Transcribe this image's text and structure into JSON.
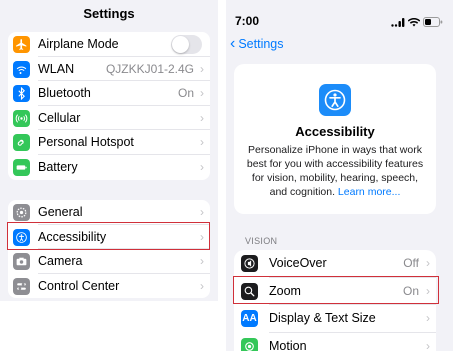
{
  "left": {
    "title": "Settings",
    "group1": [
      {
        "label": "Airplane Mode",
        "icon": "airplane-icon",
        "color": "#ff9500",
        "toggle": true,
        "toggle_on": false
      },
      {
        "label": "WLAN",
        "value": "QJZKKJ01-2.4G",
        "icon": "wifi-icon",
        "color": "#007aff"
      },
      {
        "label": "Bluetooth",
        "value": "On",
        "icon": "bluetooth-icon",
        "color": "#007aff"
      },
      {
        "label": "Cellular",
        "icon": "cellular-icon",
        "color": "#34c759"
      },
      {
        "label": "Personal Hotspot",
        "icon": "hotspot-icon",
        "color": "#34c759"
      },
      {
        "label": "Battery",
        "icon": "battery-icon",
        "color": "#34c759"
      }
    ],
    "group2": [
      {
        "label": "General",
        "icon": "gear-icon",
        "color": "#8e8e93"
      },
      {
        "label": "Accessibility",
        "icon": "accessibility-icon",
        "color": "#007aff"
      },
      {
        "label": "Camera",
        "icon": "camera-icon",
        "color": "#8e8e93"
      },
      {
        "label": "Control Center",
        "icon": "control-center-icon",
        "color": "#8e8e93"
      }
    ]
  },
  "right": {
    "status": {
      "time": "7:00"
    },
    "back_label": "Settings",
    "card": {
      "title": "Accessibility",
      "description": "Personalize iPhone in ways that work best for you with accessibility features for vision, mobility, hearing, speech, and cognition.",
      "link": "Learn more..."
    },
    "section_header": "VISION",
    "rows": [
      {
        "label": "VoiceOver",
        "value": "Off",
        "icon": "voiceover-icon",
        "color": "#1c1c1e"
      },
      {
        "label": "Zoom",
        "value": "On",
        "icon": "zoom-icon",
        "color": "#1c1c1e"
      },
      {
        "label": "Display & Text Size",
        "value": "",
        "icon": "text-size-icon",
        "color": "#007aff"
      },
      {
        "label": "Motion",
        "value": "",
        "icon": "motion-icon",
        "color": "#34c759"
      }
    ]
  },
  "highlight_color": "#d0303a"
}
